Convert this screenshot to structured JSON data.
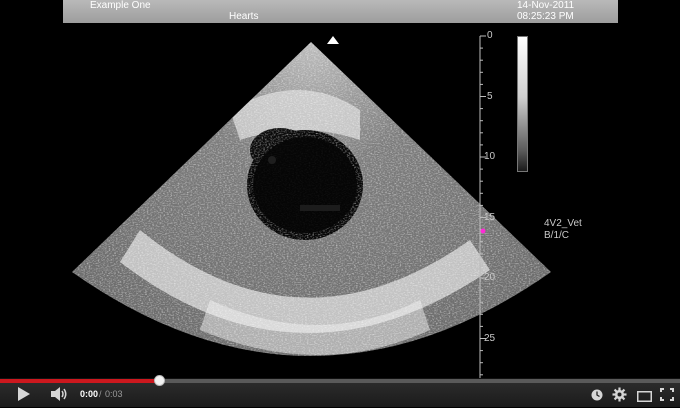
{
  "header": {
    "study": "Example One",
    "subject": "Hearts",
    "date": "14-Nov-2011",
    "time": "08:25:23 PM"
  },
  "depth_scale": {
    "ticks": [
      "0",
      "5",
      "10",
      "15",
      "20",
      "25"
    ]
  },
  "probe": {
    "line1": "4V2_Vet",
    "line2": "B/1/C"
  },
  "player": {
    "current_time": "0:00",
    "separator": "/",
    "duration": "0:03",
    "progress_fraction": 0.235,
    "buffered_fraction": 0.235,
    "accent_color": "#cc181e"
  },
  "icons": {
    "play": "play-icon",
    "volume": "volume-icon",
    "watch_later": "clock-icon",
    "settings": "gear-icon",
    "miniplayer": "miniplayer-icon",
    "fullscreen": "fullscreen-icon"
  }
}
